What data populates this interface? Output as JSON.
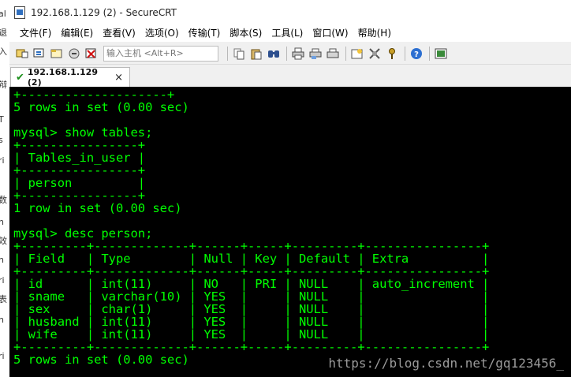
{
  "window": {
    "title": "192.168.1.129 (2) - SecureCRT"
  },
  "left_fragments": [
    "al",
    "退",
    "入",
    "辩",
    "T",
    "s",
    "ri",
    "数",
    "h",
    "效",
    "h",
    "ri",
    "表",
    "h",
    "ri"
  ],
  "menu": [
    "文件(F)",
    "编辑(E)",
    "查看(V)",
    "选项(O)",
    "传输(T)",
    "脚本(S)",
    "工具(L)",
    "窗口(W)",
    "帮助(H)"
  ],
  "toolbar": {
    "quick_connect_placeholder": "输入主机 <Alt+R>"
  },
  "tab": {
    "label": "192.168.1.129 (2)",
    "close": "×"
  },
  "terminal": {
    "lines": [
      "+--------------------+",
      "5 rows in set (0.00 sec)",
      "",
      "mysql> show tables;",
      "+----------------+",
      "| Tables_in_user |",
      "+----------------+",
      "| person         |",
      "+----------------+",
      "1 row in set (0.00 sec)",
      "",
      "mysql> desc person;",
      "+---------+-------------+------+-----+---------+----------------+",
      "| Field   | Type        | Null | Key | Default | Extra          |",
      "+---------+-------------+------+-----+---------+----------------+",
      "| id      | int(11)     | NO   | PRI | NULL    | auto_increment |",
      "| sname   | varchar(10) | YES  |     | NULL    |                |",
      "| sex     | char(1)     | YES  |     | NULL    |                |",
      "| husband | int(11)     | YES  |     | NULL    |                |",
      "| wife    | int(11)     | YES  |     | NULL    |                |",
      "+---------+-------------+------+-----+---------+----------------+",
      "5 rows in set (0.00 sec)"
    ]
  },
  "watermark": "https://blog.csdn.net/gq123456_"
}
